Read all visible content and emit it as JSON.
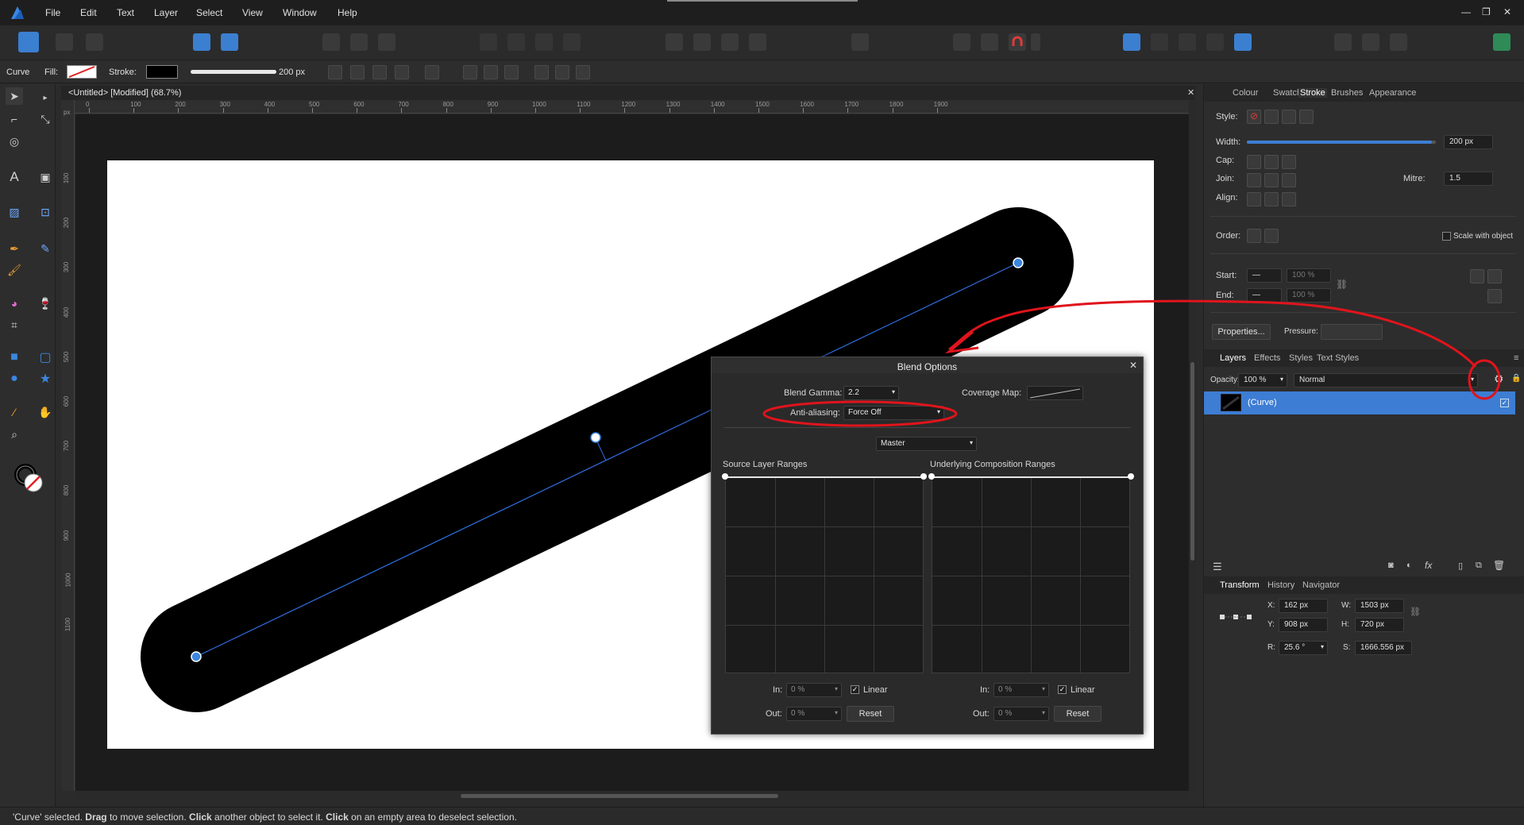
{
  "menu": [
    "File",
    "Edit",
    "Text",
    "Layer",
    "Select",
    "View",
    "Window",
    "Help"
  ],
  "context_toolbar": {
    "object_type": "Curve",
    "fill_label": "Fill:",
    "stroke_label": "Stroke:",
    "stroke_width": "200 px"
  },
  "document": {
    "tab_title": "<Untitled> [Modified] (68.7%)"
  },
  "ruler": {
    "unit": "px",
    "top_ticks": [
      "0",
      "100",
      "200",
      "300",
      "400",
      "500",
      "600",
      "700",
      "800",
      "900",
      "1000",
      "1100",
      "1200",
      "1300",
      "1400",
      "1500",
      "1600",
      "1700",
      "1800",
      "1900"
    ],
    "left_ticks": [
      "100",
      "200",
      "300",
      "400",
      "500",
      "600",
      "700",
      "800",
      "900",
      "1000",
      "1100"
    ]
  },
  "stroke_panel": {
    "tabs": [
      "Colour",
      "Swatches",
      "Stroke",
      "Brushes",
      "Appearance"
    ],
    "active_tab": "Stroke",
    "style_label": "Style:",
    "width_label": "Width:",
    "width_value": "200 px",
    "width_fraction": 0.98,
    "cap_label": "Cap:",
    "join_label": "Join:",
    "mitre_label": "Mitre:",
    "mitre_value": "1.5",
    "align_label": "Align:",
    "order_label": "Order:",
    "scale_with_object": "Scale with object",
    "start_label": "Start:",
    "start_pct": "100 %",
    "end_label": "End:",
    "end_pct": "100 %",
    "properties_button": "Properties...",
    "pressure_label": "Pressure:"
  },
  "layers_panel": {
    "tabs": [
      "Layers",
      "Effects",
      "Styles",
      "Text Styles"
    ],
    "active_tab": "Layers",
    "opacity_label": "Opacity:",
    "opacity_value": "100 %",
    "blend_mode": "Normal",
    "layer_name": "(Curve)"
  },
  "transform_panel": {
    "tabs": [
      "Transform",
      "History",
      "Navigator"
    ],
    "active_tab": "Transform",
    "x_label": "X:",
    "x_value": "162 px",
    "y_label": "Y:",
    "y_value": "908 px",
    "w_label": "W:",
    "w_value": "1503 px",
    "h_label": "H:",
    "h_value": "720 px",
    "r_label": "R:",
    "r_value": "25.6 °",
    "s_label": "S:",
    "s_value": "1666.556 px"
  },
  "blend_dialog": {
    "title": "Blend Options",
    "blend_gamma_label": "Blend Gamma:",
    "blend_gamma_value": "2.2",
    "coverage_map_label": "Coverage Map:",
    "antialiasing_label": "Anti-aliasing:",
    "antialiasing_value": "Force Off",
    "channel": "Master",
    "source_ranges_label": "Source Layer Ranges",
    "underlying_ranges_label": "Underlying Composition Ranges",
    "in_label": "In:",
    "out_label": "Out:",
    "in_value": "0 %",
    "out_value": "0 %",
    "linear_label": "Linear",
    "reset_label": "Reset"
  },
  "status": {
    "part1": "'Curve' selected. ",
    "drag": "Drag",
    "part2": " to move selection. ",
    "click1": "Click",
    "part3": " another object to select it. ",
    "click2": "Click",
    "part4": " on an empty area to deselect selection."
  },
  "colors": {
    "accent_blue": "#3d7dd3",
    "annotation_red": "#e0141c",
    "curve_line": "#2f6fe0"
  }
}
